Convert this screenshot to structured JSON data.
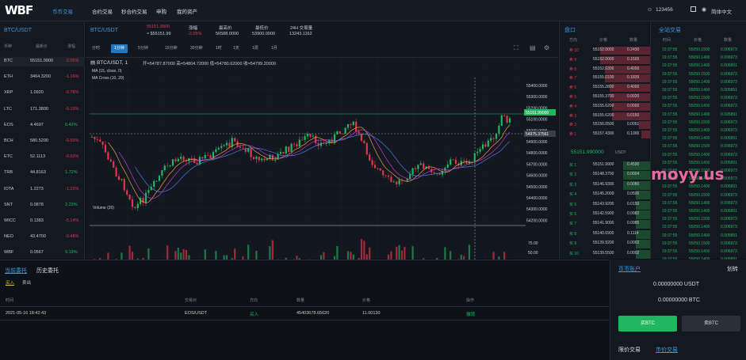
{
  "brand": {
    "logo": "WBF"
  },
  "nav": {
    "items": [
      "币币交易",
      "合约交易",
      "秒合约交易",
      "申购",
      "我的资产"
    ],
    "user": "123456",
    "lang": "简体中文"
  },
  "market_list": {
    "title": "BTC/USDT",
    "headers": [
      "币种",
      "最新价",
      "涨幅"
    ],
    "rows": [
      {
        "coin": "BTC",
        "price": "55151.9900",
        "change": "-2.05%",
        "dir": "down"
      },
      {
        "coin": "ETH",
        "price": "3464.3200",
        "change": "-1.16%",
        "dir": "down"
      },
      {
        "coin": "XRP",
        "price": "1.0920",
        "change": "-0.78%",
        "dir": "down"
      },
      {
        "coin": "LTC",
        "price": "171.3800",
        "change": "-0.19%",
        "dir": "down"
      },
      {
        "coin": "EOS",
        "price": "4.4697",
        "change": "0.42%",
        "dir": "up"
      },
      {
        "coin": "BCH",
        "price": "580.5200",
        "change": "-0.59%",
        "dir": "down"
      },
      {
        "coin": "ETC",
        "price": "52.1113",
        "change": "-0.92%",
        "dir": "down"
      },
      {
        "coin": "TRB",
        "price": "44.8163",
        "change": "1.72%",
        "dir": "up"
      },
      {
        "coin": "IOTA",
        "price": "1.2273",
        "change": "-1.22%",
        "dir": "down"
      },
      {
        "coin": "SNT",
        "price": "0.0878",
        "change": "2.23%",
        "dir": "up"
      },
      {
        "coin": "WICC",
        "price": "0.1383",
        "change": "-5.14%",
        "dir": "down"
      },
      {
        "coin": "NEO",
        "price": "43.4700",
        "change": "-0.48%",
        "dir": "down"
      },
      {
        "coin": "WBF",
        "price": "0.0567",
        "change": "9.19%",
        "dir": "up"
      }
    ]
  },
  "ticker": {
    "pair": "BTC/USDT",
    "last": "55151.9900",
    "last_cny": "≈ $55151.99",
    "change_label": "涨幅",
    "change": "-2.05%",
    "high_label": "最高价",
    "high": "56588.0000",
    "low_label": "最低价",
    "low": "53900.0000",
    "vol_label": "24H 交易量",
    "vol": "13243.1162"
  },
  "chart": {
    "intervals": [
      "分时",
      "1分钟",
      "5分钟",
      "15分钟",
      "30分钟",
      "1时",
      "1天",
      "1周",
      "1月"
    ],
    "active_interval": "1分钟",
    "legend_title": "BTC/USDT, 1",
    "ohlc": "开=54787.87000  高=54804.72000  低=54780.62000  收=54799.20000",
    "ma1": "MA (15, close, 0)",
    "ma2": "MA Cross (10, 20)",
    "vol_label": "Volume (20)",
    "y_ticks": [
      "55400.0000",
      "55300.0000",
      "55200.0000",
      "55100.0000",
      "55000.0000",
      "54900.0000",
      "54800.0000",
      "54700.0000",
      "54600.0000",
      "54500.0000",
      "54400.0000",
      "54300.0000",
      "54200.0000"
    ],
    "price_tag": "55151.99000",
    "cross_tag": "54975.37561",
    "vol_ticks": [
      "75.00",
      "50.00",
      "25.00"
    ],
    "x_ticks": [
      "5:45",
      "17:00",
      "17:15",
      "17:30",
      "17:45",
      "18:00",
      "18:15",
      "18:30",
      "18:45",
      "19:00",
      "19:15",
      "19:45"
    ],
    "cross_time": "2021-10-13 19:28:00"
  },
  "orderbook": {
    "title": "盘口",
    "headers": [
      "方向",
      "价格",
      "数量"
    ],
    "asks": [
      {
        "side": "卖 10",
        "price": "55152.0000",
        "qty": "0.2430"
      },
      {
        "side": "卖 9",
        "price": "55152.0000",
        "qty": "0.1500"
      },
      {
        "side": "卖 8",
        "price": "55152.0300",
        "qty": "0.4000"
      },
      {
        "side": "卖 7",
        "price": "55155.0100",
        "qty": "0.1839"
      },
      {
        "side": "卖 6",
        "price": "55155.2800",
        "qty": "0.4000"
      },
      {
        "side": "卖 5",
        "price": "55155.3700",
        "qty": "0.0020"
      },
      {
        "side": "卖 4",
        "price": "55155.6200",
        "qty": "0.0000"
      },
      {
        "side": "卖 3",
        "price": "55155.6200",
        "qty": "0.0150"
      },
      {
        "side": "卖 2",
        "price": "55156.0500",
        "qty": "0.0051"
      },
      {
        "side": "卖 1",
        "price": "55157.4300",
        "qty": "0.1000"
      }
    ],
    "last": "55151.990000",
    "last_unit": "USDT",
    "bids": [
      {
        "side": "买 1",
        "price": "55151.9900",
        "qty": "0.4590"
      },
      {
        "side": "买 2",
        "price": "55148.3700",
        "qty": "0.0004"
      },
      {
        "side": "买 3",
        "price": "55146.9300",
        "qty": "0.0080"
      },
      {
        "side": "买 4",
        "price": "55145.2000",
        "qty": "0.0500"
      },
      {
        "side": "买 5",
        "price": "55143.9200",
        "qty": "0.0150"
      },
      {
        "side": "买 6",
        "price": "55142.5900",
        "qty": "0.0982"
      },
      {
        "side": "买 7",
        "price": "55141.9000",
        "qty": "0.0985"
      },
      {
        "side": "买 8",
        "price": "55140.6900",
        "qty": "0.1114"
      },
      {
        "side": "买 9",
        "price": "55139.9200",
        "qty": "0.0002"
      },
      {
        "side": "买 10",
        "price": "55139.5500",
        "qty": "0.0002"
      }
    ]
  },
  "trades": {
    "title": "全站交易",
    "headers": [
      "时间",
      "价格",
      "数量"
    ],
    "rows": [
      [
        "19:37:55",
        "55050.1500",
        "0.006973"
      ],
      [
        "19:37:55",
        "55050.1400",
        "0.006973"
      ],
      [
        "19:37:55",
        "55050.1400",
        "0.005891"
      ],
      [
        "19:37:55",
        "55050.1500",
        "0.006973"
      ],
      [
        "19:37:55",
        "55050.1400",
        "0.006973"
      ],
      [
        "19:37:55",
        "55050.1400",
        "0.005891"
      ],
      [
        "19:37:55",
        "55050.1500",
        "0.006973"
      ],
      [
        "19:37:55",
        "55050.1400",
        "0.006973"
      ],
      [
        "19:37:55",
        "55050.1400",
        "0.005891"
      ],
      [
        "19:37:55",
        "55050.1500",
        "0.006973"
      ],
      [
        "19:37:55",
        "55050.1400",
        "0.006973"
      ],
      [
        "19:37:55",
        "55050.1400",
        "0.005891"
      ],
      [
        "19:37:55",
        "55050.1500",
        "0.006973"
      ],
      [
        "19:37:55",
        "55050.1400",
        "0.006973"
      ],
      [
        "19:37:55",
        "55050.1400",
        "0.005891"
      ],
      [
        "19:37:55",
        "55050.1500",
        "0.006973"
      ],
      [
        "19:37:55",
        "55050.1400",
        "0.006973"
      ],
      [
        "19:37:55",
        "55050.1400",
        "0.005891"
      ],
      [
        "19:37:55",
        "55050.1500",
        "0.006973"
      ],
      [
        "19:37:55",
        "55050.1400",
        "0.006973"
      ],
      [
        "19:37:55",
        "55050.1400",
        "0.005891"
      ],
      [
        "19:37:55",
        "55050.1500",
        "0.006973"
      ],
      [
        "19:37:55",
        "55050.1400",
        "0.006973"
      ],
      [
        "19:37:55",
        "55050.1400",
        "0.005891"
      ],
      [
        "19:37:55",
        "55050.1500",
        "0.006973"
      ],
      [
        "19:37:55",
        "55050.1400",
        "0.006973"
      ],
      [
        "19:37:55",
        "55050.1400",
        "0.005891"
      ]
    ]
  },
  "watermark": "moyy.us",
  "orders": {
    "tabs": [
      "当前委托",
      "历史委托"
    ],
    "subtabs": [
      "买入",
      "卖出"
    ],
    "headers": [
      "时间",
      "交易对",
      "方向",
      "数量",
      "价格",
      "操作"
    ],
    "rows": [
      {
        "time": "2021-05-16 18:42:43",
        "pair": "EOS/USDT",
        "side": "买入",
        "qty": "45403678.65620",
        "price": "11.00130",
        "action": "撤销"
      }
    ]
  },
  "account": {
    "tab": "币币账户",
    "transfer": "划转",
    "usdt": "0.00000000 USDT",
    "btc": "0.00000000 BTC",
    "buy": "买BTC",
    "sell": "卖BTC",
    "limit": "限价交易",
    "market": "市价交易"
  },
  "colors": {
    "up": "#1fb860",
    "down": "#e0384a",
    "accent": "#1e79c0"
  }
}
